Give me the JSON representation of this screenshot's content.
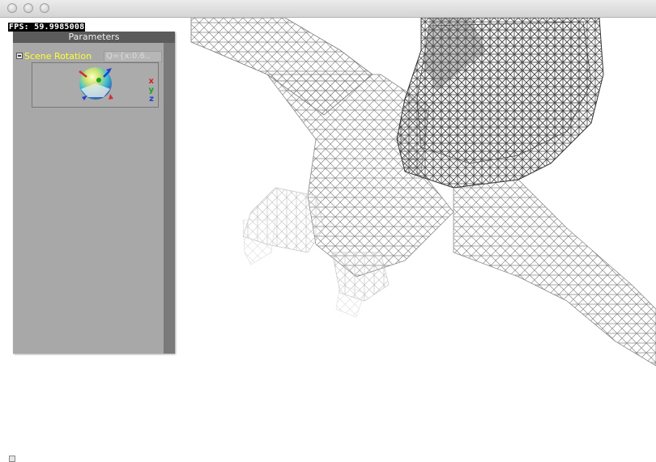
{
  "window": {
    "traffic_lights": [
      "close",
      "minimize",
      "zoom"
    ]
  },
  "fps": {
    "text": "FPS: 59.9985008"
  },
  "panel": {
    "title": "Parameters",
    "rows": [
      {
        "label": "Scene Rotation",
        "value": "Q={x:0.6.."
      }
    ],
    "axes": [
      {
        "label": "x",
        "color": "#d02020"
      },
      {
        "label": "y",
        "color": "#20a020"
      },
      {
        "label": "z",
        "color": "#2040d0"
      }
    ]
  },
  "colors": {
    "label_yellow": "#ffff30",
    "panel_bg": "#a8a8a8",
    "panel_header": "#5b5b5b"
  },
  "icons": [
    "close-icon",
    "minimize-icon",
    "zoom-icon",
    "collapse-icon",
    "rotation-gizmo-icon",
    "status-icon"
  ]
}
